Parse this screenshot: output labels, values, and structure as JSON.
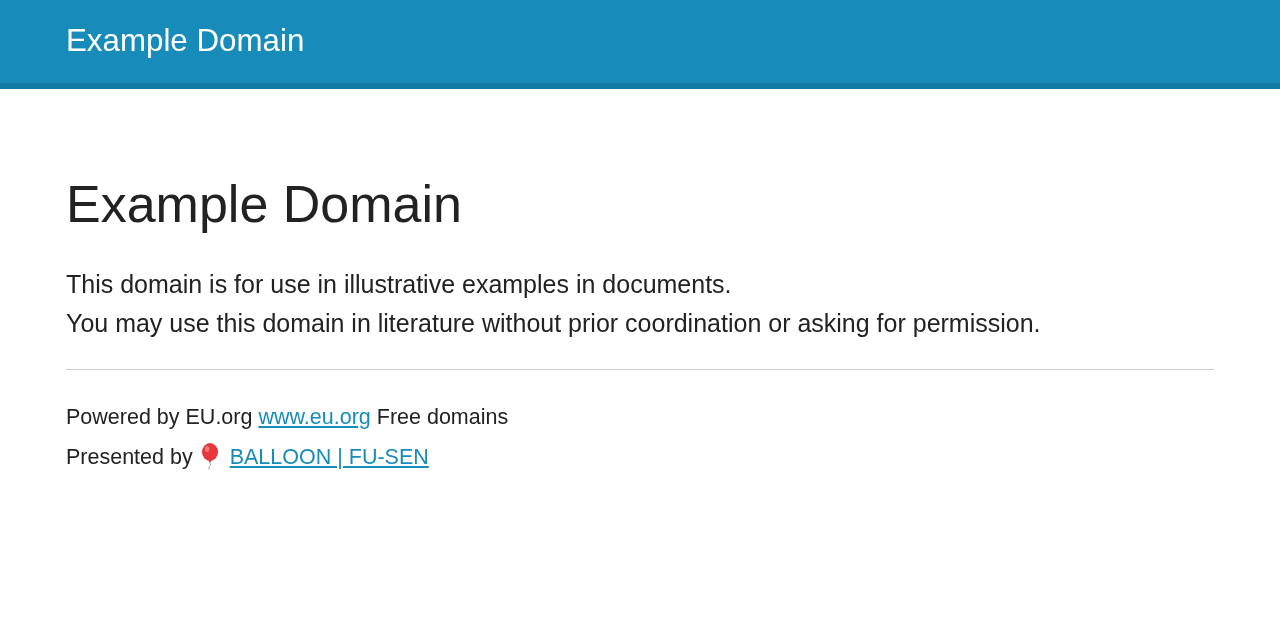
{
  "header": {
    "title": "Example Domain"
  },
  "main": {
    "heading": "Example Domain",
    "paragraphs": [
      "This domain is for use in illustrative examples in documents.",
      "You may use this domain in literature without prior coordination or asking for permission."
    ]
  },
  "footer": {
    "lines": [
      {
        "parts": [
          {
            "kind": "text",
            "text": "Powered by EU.org"
          },
          {
            "kind": "link",
            "text": "www.eu.org",
            "has_icon": false
          },
          {
            "kind": "text",
            "text": "Free domains"
          }
        ]
      },
      {
        "parts": [
          {
            "kind": "text",
            "text": "Presented by"
          },
          {
            "kind": "link",
            "text": "BALLOON | FU-SEN",
            "has_icon": true
          }
        ]
      }
    ]
  }
}
